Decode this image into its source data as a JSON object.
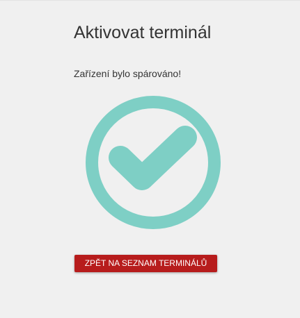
{
  "page": {
    "title": "Aktivovat terminál",
    "message": "Zařízení bylo spárováno!"
  },
  "success_icon": {
    "icon": "check-circle-icon",
    "color": "#7ecfc5"
  },
  "actions": {
    "back_label": "ZPĚT NA SEZNAM TERMINÁLŮ",
    "back_color": "#b71c1c"
  }
}
